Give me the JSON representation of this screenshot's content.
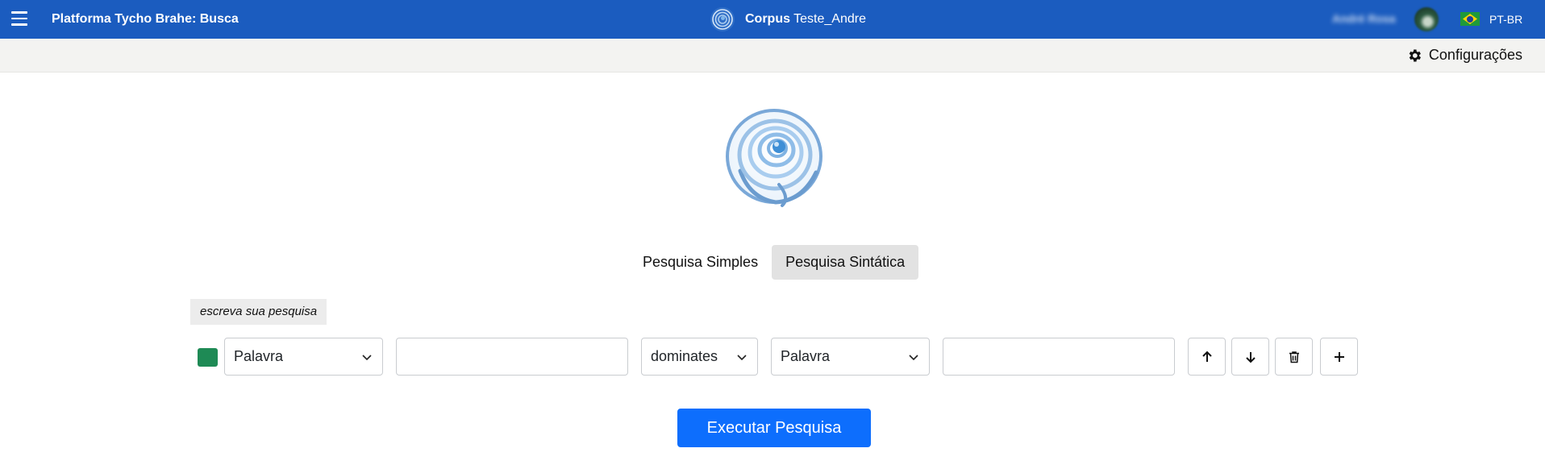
{
  "header": {
    "app_title": "Platforma Tycho Brahe: Busca",
    "corpus_label": "Corpus",
    "corpus_name": "Teste_Andre",
    "user_name": "André Rosa",
    "language": "PT-BR",
    "bg_color": "#1b5cbf",
    "icons": [
      "menu-icon",
      "corpus-logo-icon",
      "avatar",
      "brazil-flag-icon"
    ]
  },
  "toolbar": {
    "settings_label": "Configurações",
    "settings_icon": "gear-icon"
  },
  "tabs": [
    {
      "label": "Pesquisa Simples",
      "active": false
    },
    {
      "label": "Pesquisa Sintática",
      "active": true
    }
  ],
  "query": {
    "hint": "escreva sua pesquisa",
    "row": {
      "color": "#1e8a55",
      "left_type": "Palavra",
      "left_value": "",
      "relation": "dominates",
      "right_type": "Palavra",
      "right_value": "",
      "actions": [
        "arrow-up-icon",
        "arrow-down-icon",
        "trash-icon",
        "plus-icon"
      ]
    }
  },
  "run_button": {
    "label": "Executar Pesquisa",
    "color": "#0d6efd"
  }
}
